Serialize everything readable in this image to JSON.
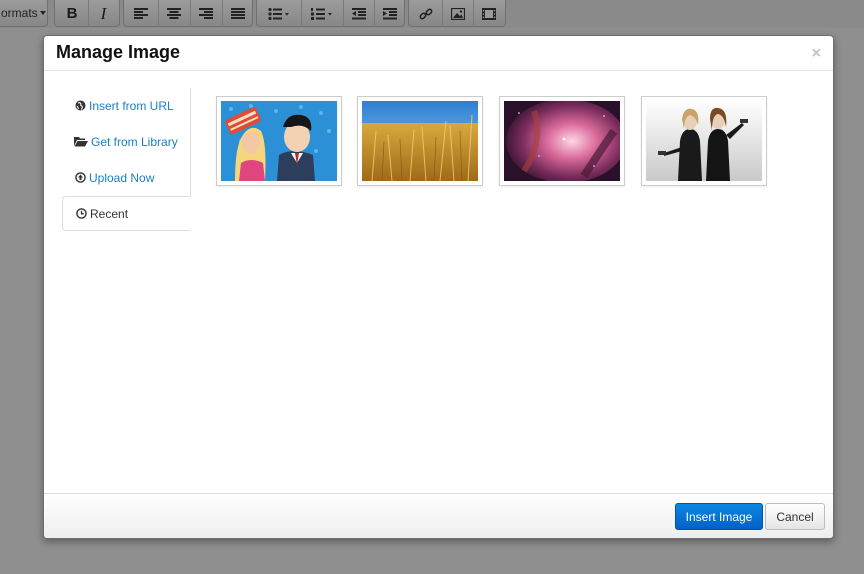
{
  "toolbar": {
    "formats_label": "ormats",
    "icons": [
      "bold-icon",
      "italic-icon",
      "align-left-icon",
      "align-center-icon",
      "align-right-icon",
      "align-justify-icon",
      "bullet-list-icon",
      "numbered-list-icon",
      "outdent-icon",
      "indent-icon",
      "link-icon",
      "image-icon",
      "video-icon"
    ],
    "bold_glyph": "B",
    "italic_glyph": "I"
  },
  "modal": {
    "title": "Manage Image",
    "close_glyph": "×",
    "tabs": [
      {
        "label": "Insert from URL",
        "icon": "globe-icon"
      },
      {
        "label": "Get from Library",
        "icon": "folder-open-icon"
      },
      {
        "label": "Upload Now",
        "icon": "upload-icon"
      },
      {
        "label": "Recent",
        "icon": "clock-icon",
        "active": true
      }
    ],
    "thumbnails": [
      "cartoon-image",
      "wheat-field-image",
      "nebula-image",
      "two-women-image"
    ],
    "footer": {
      "insert_label": "Insert Image",
      "cancel_label": "Cancel"
    }
  },
  "colors": {
    "link": "#1b7fc1",
    "primary": "#0670d4",
    "overlay": "#8f8f8f"
  }
}
